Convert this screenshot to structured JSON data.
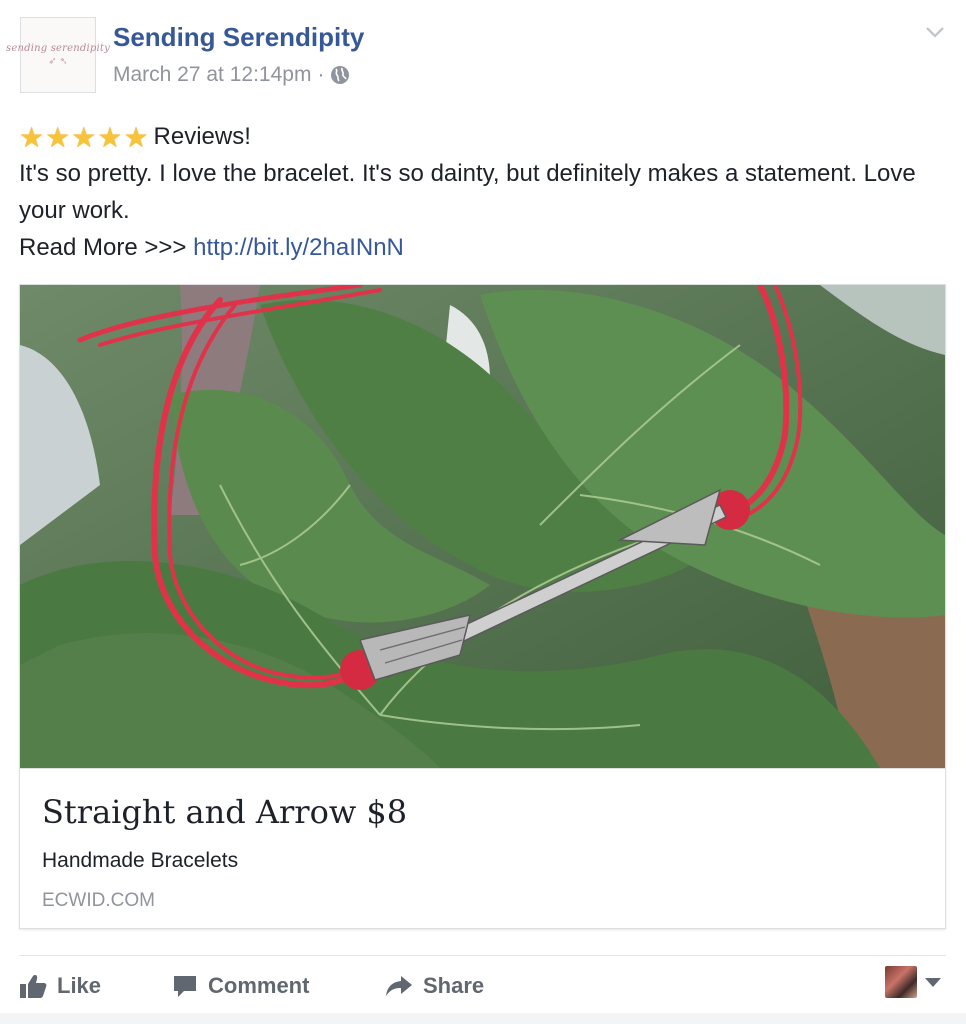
{
  "post": {
    "page_name": "Sending Serendipity",
    "timestamp": "March 27 at 12:14pm",
    "separator": "·",
    "avatar_logo_text": "sending serendipity",
    "privacy_icon": "globe-icon",
    "menu_icon": "chevron-down-icon",
    "star_rating": 5,
    "headline": "Reviews!",
    "body_line": "It's so pretty. I love the bracelet. It's so dainty, but definitely makes a statement. Love your work.",
    "read_more_label": "Read More >>>",
    "read_more_link": "http://bit.ly/2haINnN"
  },
  "link_card": {
    "image_alt": "Red string bracelet with silver arrow on fig leaves",
    "title": "Straight and Arrow $8",
    "description": "Handmade Bracelets",
    "domain": "ECWID.COM"
  },
  "actions": {
    "like_label": "Like",
    "comment_label": "Comment",
    "share_label": "Share",
    "like_icon": "thumbs-up-icon",
    "comment_icon": "speech-bubble-icon",
    "share_icon": "share-arrow-icon"
  },
  "colors": {
    "link_blue": "#365899",
    "meta_gray": "#90949c",
    "action_gray": "#606770",
    "star_gold": "#f7c33a",
    "bracelet_red": "#e0334a"
  }
}
